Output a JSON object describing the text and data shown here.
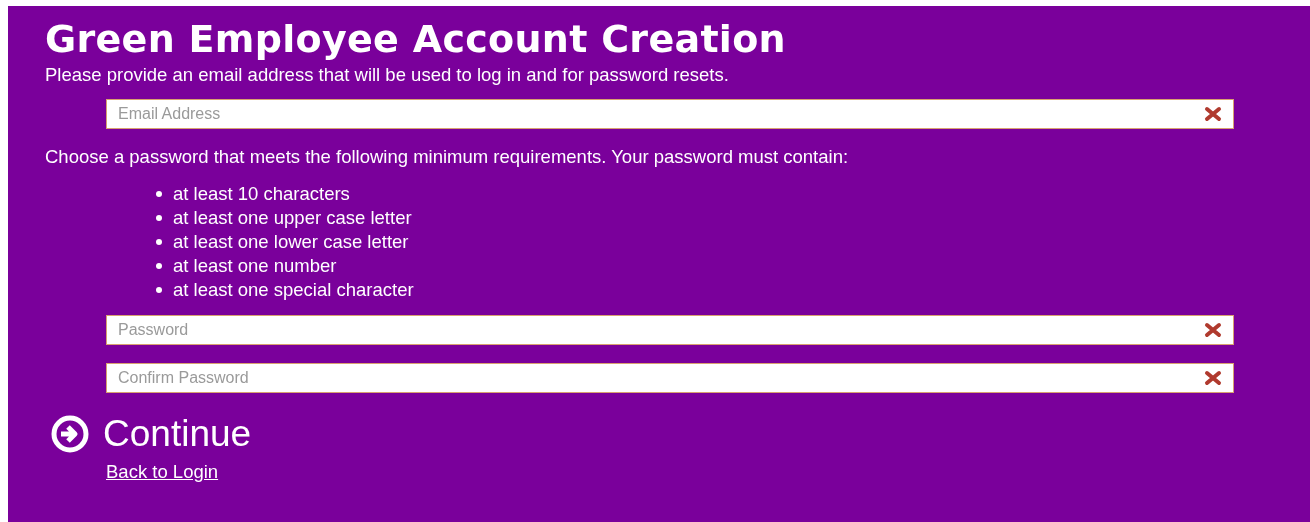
{
  "title": "Green Employee Account Creation",
  "email_prompt": "Please provide an email address that will be used to log in and for password resets.",
  "email_field": {
    "placeholder": "Email Address"
  },
  "password_prompt": "Choose a password that meets the following minimum requirements. Your password must contain:",
  "requirements": [
    "at least 10 characters",
    "at least one upper case letter",
    "at least one lower case letter",
    "at least one number",
    "at least one special character"
  ],
  "password_fields": [
    {
      "placeholder": "Password"
    },
    {
      "placeholder": "Confirm Password"
    }
  ],
  "continue_button": "Continue",
  "back_link": "Back to Login"
}
